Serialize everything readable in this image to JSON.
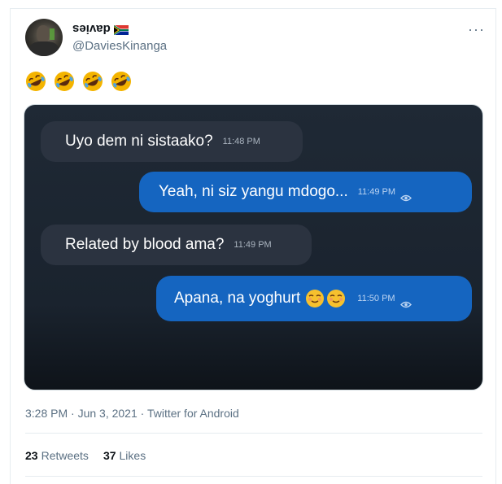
{
  "user": {
    "display_name": "davies",
    "flag_icon": "south-africa-flag-icon",
    "handle": "@DaviesKinanga"
  },
  "tweet": {
    "emojis": [
      "rofl-emoji",
      "rofl-emoji",
      "rofl-emoji",
      "rofl-emoji"
    ],
    "timestamp": "3:28 PM · Jun 3, 2021 · Twitter for Android",
    "retweets": "23",
    "retweets_label": "Retweets",
    "likes": "37",
    "likes_label": "Likes"
  },
  "chat": {
    "messages": [
      {
        "side": "in",
        "text": "Uyo dem ni sistaako?",
        "time": "11:48 PM"
      },
      {
        "side": "out",
        "text": "Yeah, ni siz yangu mdogo...",
        "time": "11:49 PM"
      },
      {
        "side": "in",
        "text": "Related by blood ama?",
        "time": "11:49 PM"
      },
      {
        "side": "out",
        "text": "Apana, na yoghurt",
        "time": "11:50 PM"
      }
    ]
  },
  "colors": {
    "outgoing_bubble": "#1565c0",
    "incoming_bubble": "#2b3340",
    "chat_background": "#1f2935"
  }
}
